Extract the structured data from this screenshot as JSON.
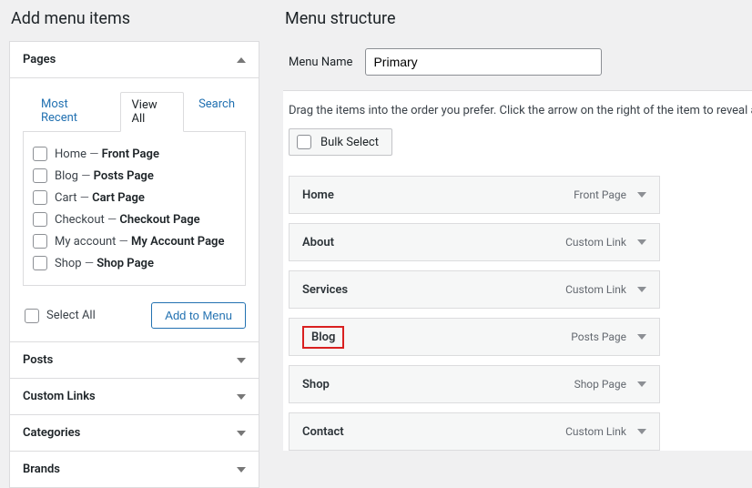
{
  "left": {
    "heading": "Add menu items",
    "accordion": {
      "pages": "Pages",
      "posts": "Posts",
      "custom_links": "Custom Links",
      "categories": "Categories",
      "brands": "Brands"
    },
    "tabs": {
      "most_recent": "Most Recent",
      "view_all": "View All",
      "search": "Search"
    },
    "page_items": [
      {
        "name": "Home",
        "suffix": "Front Page"
      },
      {
        "name": "Blog",
        "suffix": "Posts Page"
      },
      {
        "name": "Cart",
        "suffix": "Cart Page"
      },
      {
        "name": "Checkout",
        "suffix": "Checkout Page"
      },
      {
        "name": "My account",
        "suffix": "My Account Page"
      },
      {
        "name": "Shop",
        "suffix": "Shop Page"
      }
    ],
    "select_all": "Select All",
    "add_to_menu": "Add to Menu"
  },
  "right": {
    "heading": "Menu structure",
    "menu_name_label": "Menu Name",
    "menu_name_value": "Primary",
    "instructions": "Drag the items into the order you prefer. Click the arrow on the right of the item to reveal additional configuration options.",
    "bulk_select": "Bulk Select",
    "menu_items": [
      {
        "title": "Home",
        "type": "Front Page"
      },
      {
        "title": "About",
        "type": "Custom Link"
      },
      {
        "title": "Services",
        "type": "Custom Link"
      },
      {
        "title": "Blog",
        "type": "Posts Page",
        "highlight": true
      },
      {
        "title": "Shop",
        "type": "Shop Page"
      },
      {
        "title": "Contact",
        "type": "Custom Link"
      }
    ]
  }
}
